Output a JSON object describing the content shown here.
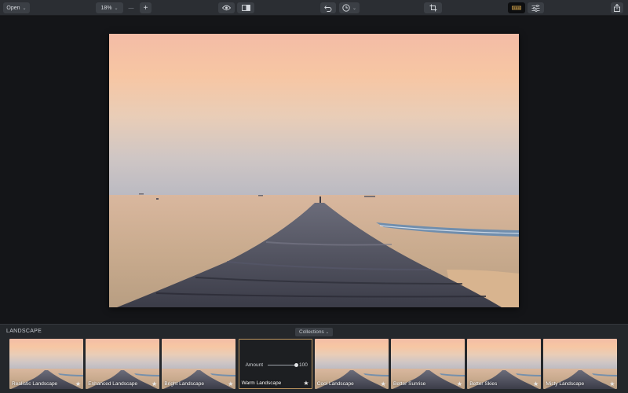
{
  "toolbar": {
    "open_label": "Open",
    "zoom_value": "18%",
    "zoom_out_symbol": "—",
    "zoom_in_symbol": "+",
    "icons": [
      "eye-icon",
      "compare-icon",
      "undo-icon",
      "history-icon",
      "crop-icon",
      "presets-icon",
      "adjustments-icon",
      "share-icon"
    ]
  },
  "panel": {
    "title": "LANDSCAPE",
    "collections_label": "Collections",
    "amount_label": "Amount",
    "amount_value": "100",
    "amount_level": 1.0,
    "presets": [
      {
        "label": "Realistic Landscape"
      },
      {
        "label": "Enhanced Landscape"
      },
      {
        "label": "Bright Landscape"
      },
      {
        "label": "Warm Landscape"
      },
      {
        "label": "Cool Landscape"
      },
      {
        "label": "Better Sunrise"
      },
      {
        "label": "Better Skies"
      },
      {
        "label": "Misty Landscape"
      }
    ],
    "selected_index": 3
  },
  "colors": {
    "accent": "#c09860",
    "toolbar_bg": "#2b2e33",
    "panel_bg": "#24272b"
  }
}
